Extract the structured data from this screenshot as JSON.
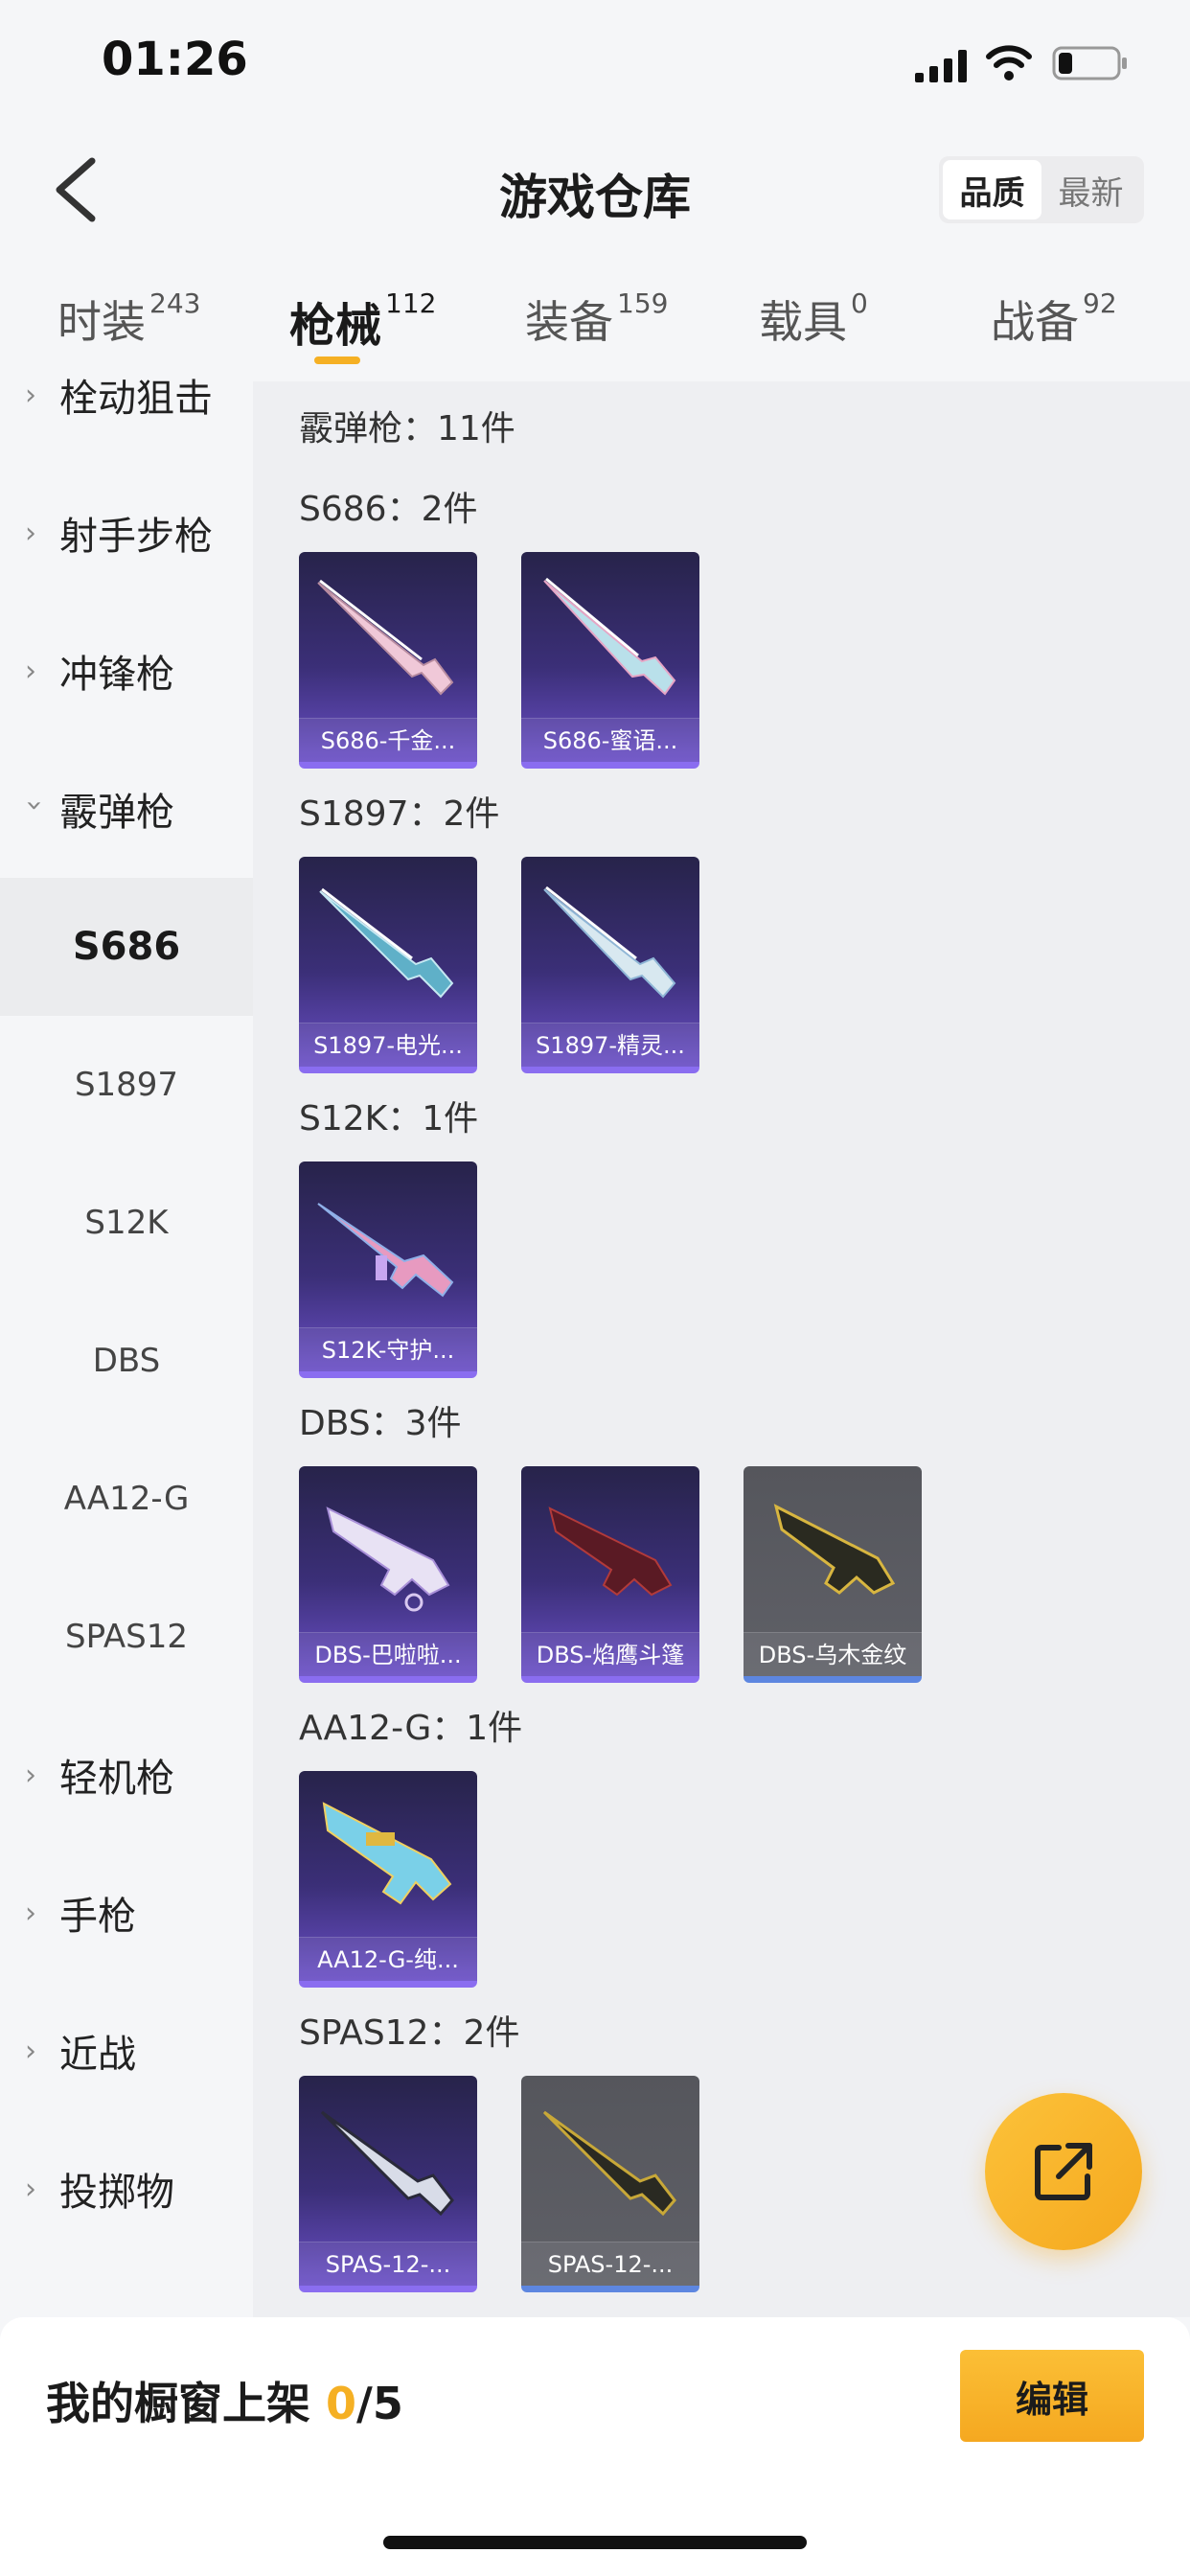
{
  "status_bar": {
    "time": "01:26"
  },
  "header": {
    "title": "游戏仓库",
    "sort_options": [
      "品质",
      "最新"
    ],
    "active_sort": "品质"
  },
  "tabs": [
    {
      "label": "时装",
      "count": "243"
    },
    {
      "label": "枪械",
      "count": "112"
    },
    {
      "label": "装备",
      "count": "159"
    },
    {
      "label": "载具",
      "count": "0"
    },
    {
      "label": "战备",
      "count": "92"
    }
  ],
  "active_tab": "枪械",
  "sidebar": {
    "categories_top": [
      "栓动狙击",
      "射手步枪",
      "冲锋枪",
      "霰弹枪"
    ],
    "subcategories": [
      "S686",
      "S1897",
      "S12K",
      "DBS",
      "AA12-G",
      "SPAS12"
    ],
    "selected_sub": "S686",
    "categories_bottom": [
      "轻机枪",
      "手枪",
      "近战",
      "投掷物"
    ]
  },
  "main": {
    "group_header": "霰弹枪：11件",
    "sections": [
      {
        "title": "S686：2件",
        "items": [
          {
            "name": "S686-千金...",
            "tier": "purple"
          },
          {
            "name": "S686-蜜语...",
            "tier": "purple"
          }
        ]
      },
      {
        "title": "S1897：2件",
        "items": [
          {
            "name": "S1897-电光...",
            "tier": "purple"
          },
          {
            "name": "S1897-精灵...",
            "tier": "purple"
          }
        ]
      },
      {
        "title": "S12K：1件",
        "items": [
          {
            "name": "S12K-守护...",
            "tier": "purple"
          }
        ]
      },
      {
        "title": "DBS：3件",
        "items": [
          {
            "name": "DBS-巴啦啦...",
            "tier": "purple"
          },
          {
            "name": "DBS-焰鹰斗篷",
            "tier": "purple"
          },
          {
            "name": "DBS-乌木金纹",
            "tier": "blue"
          }
        ]
      },
      {
        "title": "AA12-G：1件",
        "items": [
          {
            "name": "AA12-G-纯...",
            "tier": "purple"
          }
        ]
      },
      {
        "title": "SPAS12：2件",
        "items": [
          {
            "name": "SPAS-12-...",
            "tier": "purple"
          },
          {
            "name": "SPAS-12-...",
            "tier": "blue"
          }
        ]
      }
    ]
  },
  "bottom_bar": {
    "shelf_label": "我的橱窗上架 ",
    "shelf_current": "0",
    "shelf_total": "/5",
    "edit_label": "编辑"
  },
  "colors": {
    "accent": "#f5b024",
    "card_purple": "#3b2f78",
    "card_gray": "#5f6067"
  }
}
